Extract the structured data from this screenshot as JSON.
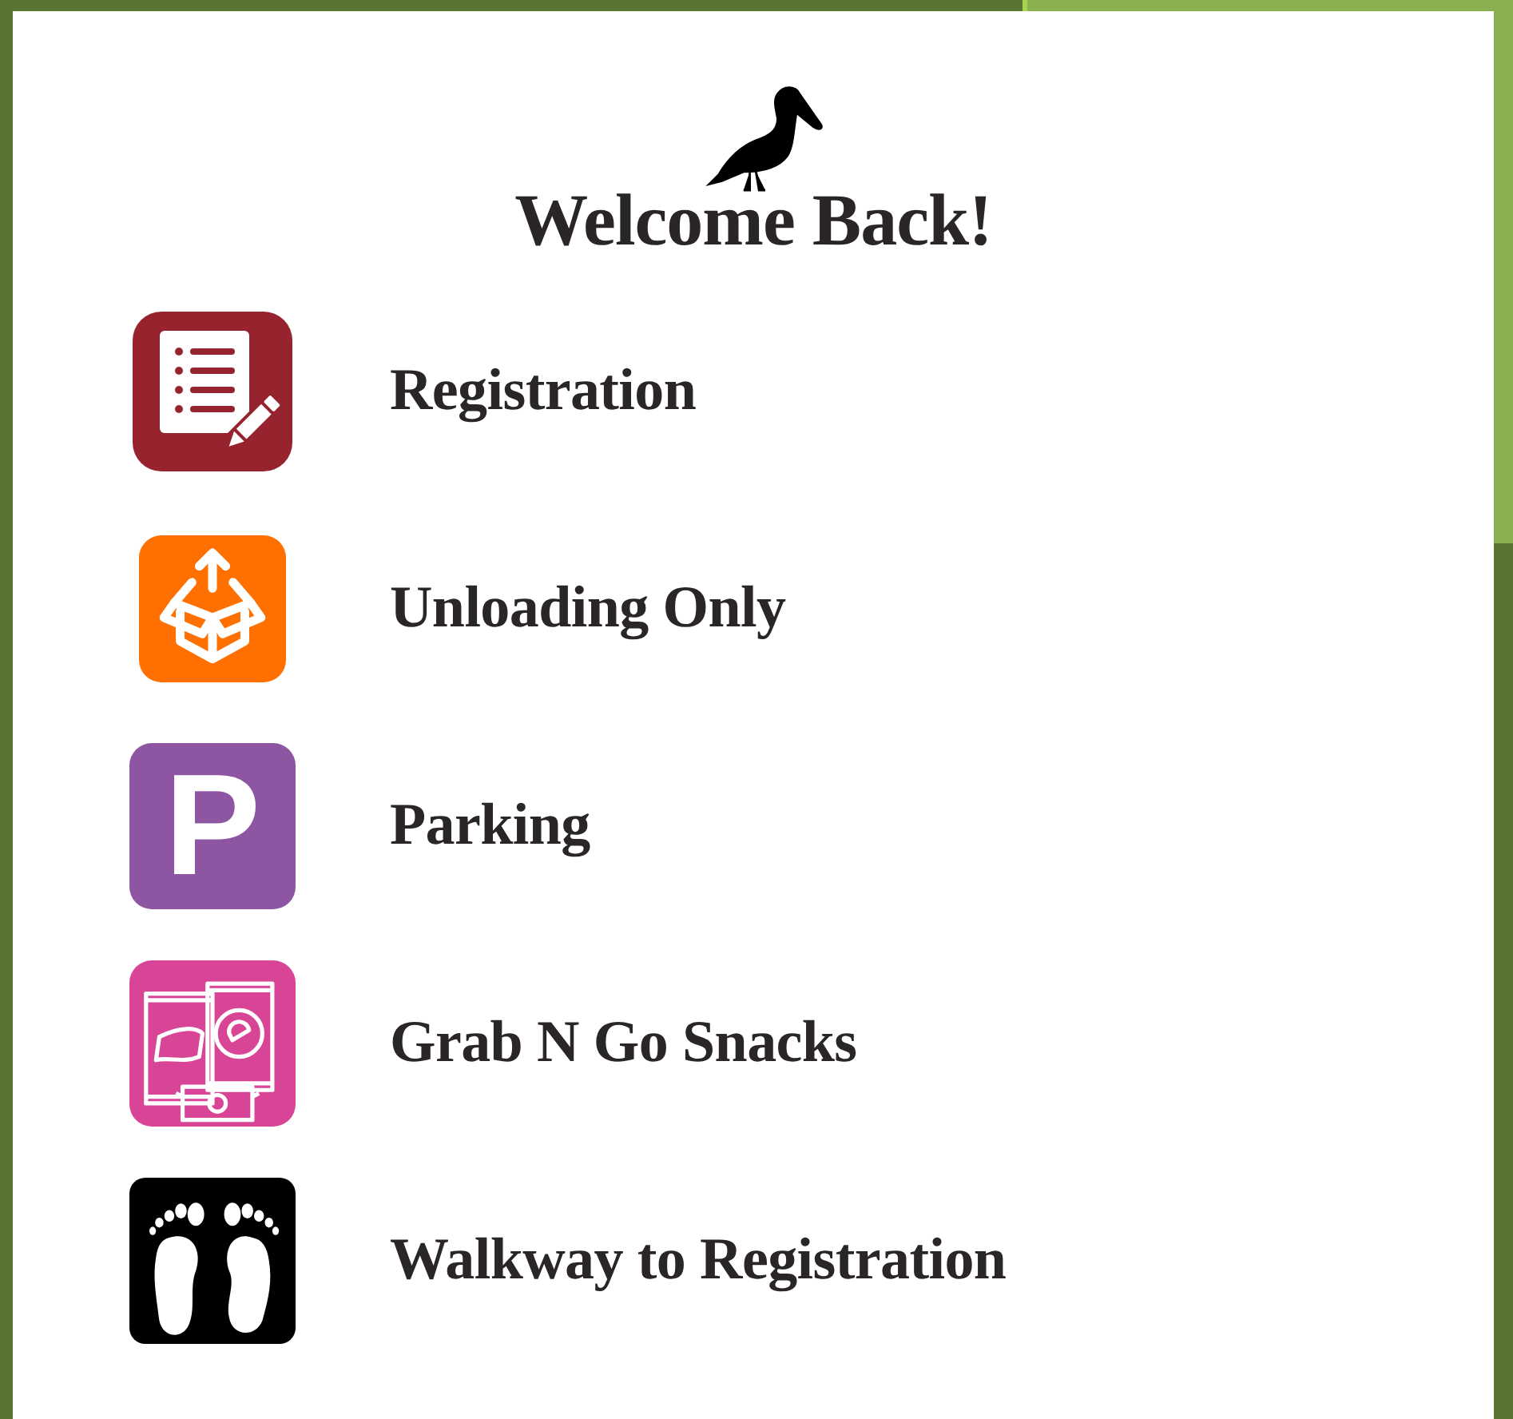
{
  "title": "Welcome Back!",
  "items": [
    {
      "kind": "registration",
      "label": "Registration",
      "color": "#96232d"
    },
    {
      "kind": "unloading",
      "label": "Unloading Only",
      "color": "#ff7000"
    },
    {
      "kind": "parking",
      "label": "Parking",
      "color": "#8e55a2",
      "symbol": "P"
    },
    {
      "kind": "snacks",
      "label": "Grab N Go Snacks",
      "color": "#d94596"
    },
    {
      "kind": "walkway",
      "label": "Walkway to Registration",
      "color": "#000000"
    }
  ]
}
